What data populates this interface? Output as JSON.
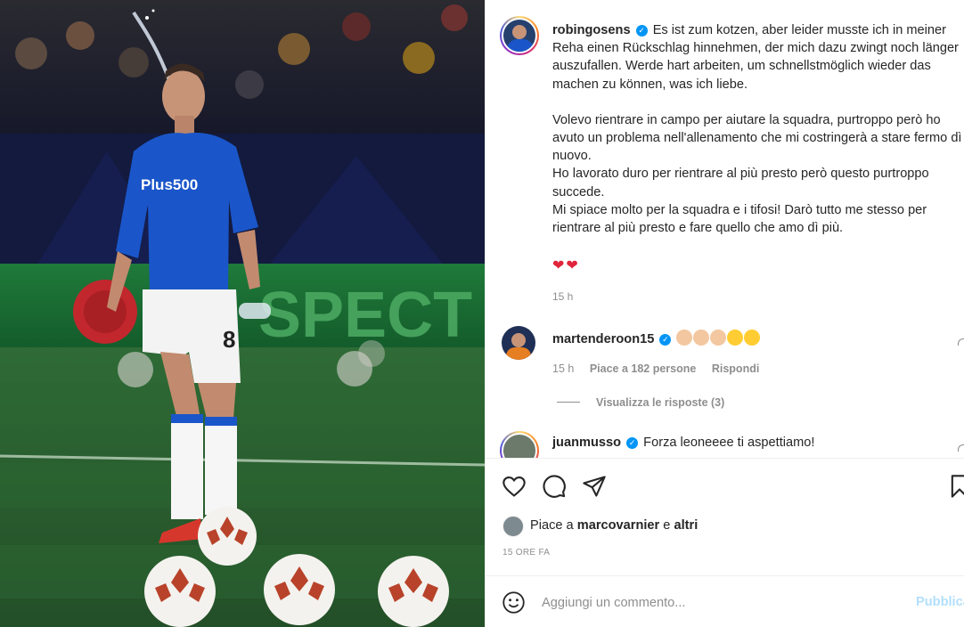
{
  "post": {
    "username": "robingosens",
    "caption_lines": [
      "Es ist zum kotzen, aber leider musste ich in meiner Reha einen Rückschlag hinnehmen, der mich dazu zwingt noch länger auszufallen. Werde hart arbeiten, um schnellstmöglich wieder das machen zu können, was ich liebe."
    ],
    "caption_it": [
      "Volevo rientrare in campo per aiutare la squadra, purtroppo però ho avuto un problema nell'allenamento che mi costringerà a stare fermo dì nuovo.",
      "Ho lavorato duro per rientrare al più presto però questo purtroppo succede.",
      "Mi spiace molto per la squadra e i tifosi! Darò tutto me stesso per rientrare al più presto e fare quello che amo dì più."
    ],
    "hearts": "❤❤",
    "time_ago": "15 h"
  },
  "comments": [
    {
      "username": "martenderoon15",
      "text": "",
      "time": "15 h",
      "likes": "Piace a 182 persone",
      "reply": "Rispondi",
      "view_replies": "Visualizza le risposte (3)"
    },
    {
      "username": "juanmusso",
      "text": "Forza leoneeee ti aspettiamo!"
    }
  ],
  "likes": {
    "prefix": "Piace a",
    "user": "marcovarnier",
    "conj": "e",
    "others": "altri"
  },
  "date": "15 ORE FA",
  "add_comment": {
    "placeholder": "Aggiungi un commento...",
    "publish": "Pubblica"
  },
  "photo": {
    "jersey_sponsor": "Plus500",
    "jersey_number": "8",
    "board_text": "SPECT"
  },
  "colors": {
    "accent": "#0095f6",
    "publish_disabled": "#b2dffc",
    "heart": "#e0243a"
  }
}
